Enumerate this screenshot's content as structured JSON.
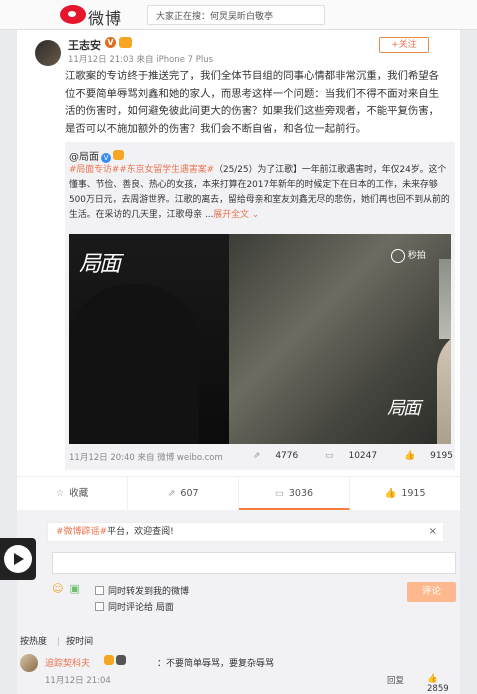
{
  "topbar": {
    "logo_text": "微博",
    "search_placeholder": "大家正在搜：何炅吴昕白敬亭"
  },
  "post": {
    "username": "王志安",
    "follow_label": "+关注",
    "meta": "11月12日 21:03 来自 iPhone 7 Plus",
    "text": "江歌案的专访终于推送完了，我们全体节目组的同事心情都非常沉重，我们希望各位不要简单辱骂刘鑫和她的家人，而思考这样一个问题：当我们不得不面对来自生活的伤害时，如何避免彼此间更大的伤害？如果我们这些旁观者，不能平复伤害，是否可以不施加额外的伤害？我们会不断自省，和各位一起前行。"
  },
  "repost": {
    "author": "@局面",
    "hashtag1": "#局面专访#",
    "hashtag2": "#东京女留学生遇害案#",
    "text": "（25/25）为了江歌】一年前江歌遇害时，年仅24岁。这个懂事、节俭、善良、热心的女孩，本来打算在2017年新年的时候定下在日本的工作，未来存够500万日元，去周游世界。江歌的离去，留给母亲和室友刘鑫无尽的悲伤，她们再也回不到从前的生活。在采访的几天里，江歌母亲 ...",
    "expand_label": "展开全文",
    "video_watermark": "局面",
    "video_badge": "秒拍",
    "footer": "11月12日 20:40 来自 微博 weibo.com",
    "reposts": "4776",
    "comments": "10247",
    "likes": "9195"
  },
  "actions": {
    "favorite": "收藏",
    "repost": "607",
    "comment": "3036",
    "like": "1915"
  },
  "comments": {
    "notice_tag": "#微博辟谣#",
    "notice_text": "平台，欢迎查阅!",
    "repost_checkbox": "同时转发到我的微博",
    "comment_checkbox": "同时评论给 局面",
    "submit_label": "评论",
    "sort_hot": "按热度",
    "sort_time": "按时间",
    "first": {
      "user": "追踪契科夫",
      "text": "：不要简单辱骂，要复杂辱骂",
      "time": "11月12日 21:04",
      "reply_label": "回复",
      "likes": "2859"
    }
  }
}
